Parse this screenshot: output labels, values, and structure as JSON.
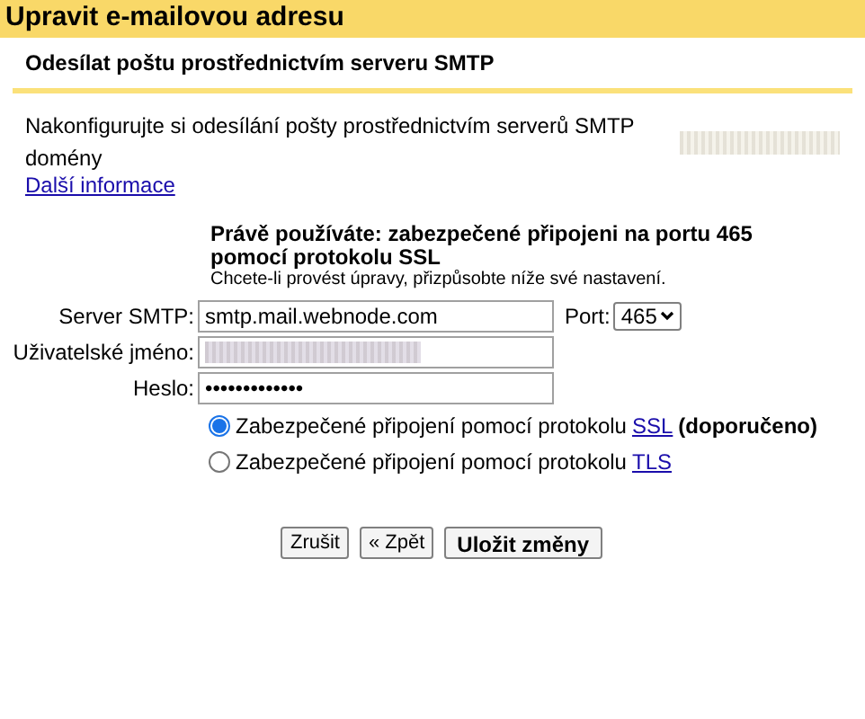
{
  "window": {
    "title": "Upravit e-mailovou adresu"
  },
  "section_title": "Odesílat poštu prostřednictvím serveru SMTP",
  "intro": {
    "text": "Nakonfigurujte si odesílání pošty prostřednictvím serverů SMTP domény",
    "link": "Další informace"
  },
  "status": {
    "heading": "Právě používáte: zabezpečené připojeni na portu 465 pomocí protokolu SSL",
    "hint": "Chcete-li provést úpravy, přizpůsobte níže své nastavení."
  },
  "fields": [
    {
      "label": "Server SMTP:",
      "kind": "text",
      "value": "smtp.mail.webnode.com"
    },
    {
      "label": "Uživatelské jméno:",
      "kind": "blurred"
    },
    {
      "label": "Heslo:",
      "kind": "text",
      "value": "•••••••••••••"
    }
  ],
  "port": {
    "label": "Port:",
    "value": "465"
  },
  "security": [
    {
      "text": "Zabezpečené připojení pomocí protokolu",
      "link": "SSL",
      "note": "(doporučeno)",
      "selected": true
    },
    {
      "text": "Zabezpečené připojení pomocí protokolu",
      "link": "TLS",
      "selected": false
    }
  ],
  "buttons": [
    {
      "label": "Zrušit",
      "kind": "plain"
    },
    {
      "label": "« Zpět",
      "kind": "plain"
    },
    {
      "label": "Uložit změny",
      "kind": "primary"
    }
  ]
}
